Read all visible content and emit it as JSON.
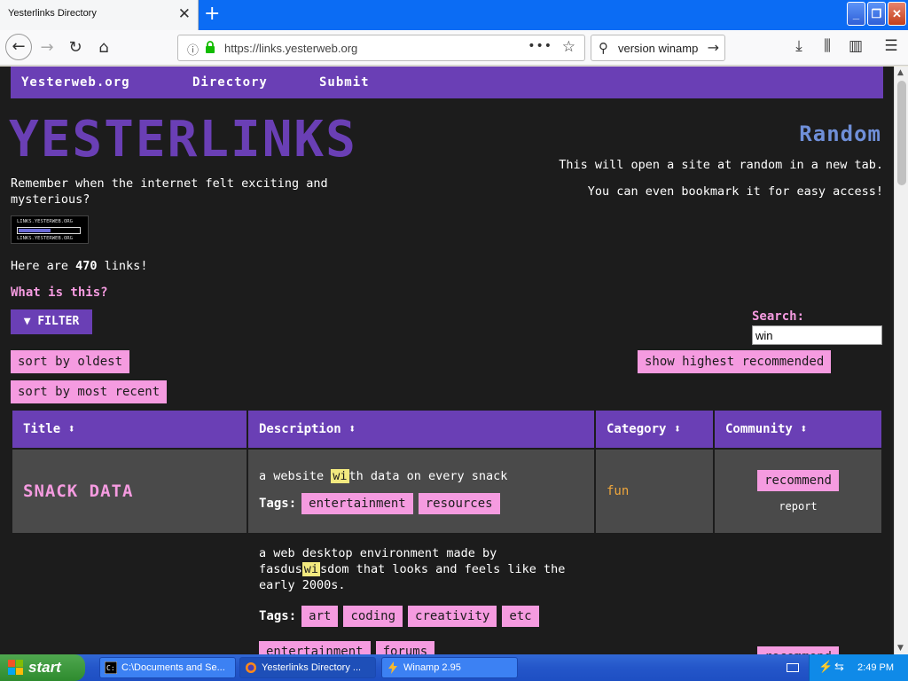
{
  "browser": {
    "tab_title": "Yesterlinks Directory",
    "url": "https://links.yesterweb.org",
    "search_query": "version winamp"
  },
  "nav": {
    "home": "Yesterweb.org",
    "directory": "Directory",
    "submit": "Submit"
  },
  "header": {
    "logo": "YESTERLINKS",
    "tagline": "Remember when the internet felt exciting and mysterious?",
    "badge_text": "LINKS.YESTERWEB.ORG",
    "count_prefix": "Here are ",
    "count": "470",
    "count_suffix": " links!",
    "what_is_this": "What is this?",
    "filter": "FILTER"
  },
  "random": {
    "title": "Random",
    "line1": "This will open a site at random in a new tab.",
    "line2": "You can even bookmark it for easy access!"
  },
  "search": {
    "label": "Search:",
    "value": "win"
  },
  "sort": {
    "oldest": "sort by oldest",
    "recent": "sort by most recent",
    "recommended": "show highest recommended"
  },
  "table": {
    "headers": [
      "Title ⬍",
      "Description ⬍",
      "Category ⬍",
      "Community ⬍"
    ],
    "tags_label": "Tags:",
    "recommend": "recommend",
    "report": "report",
    "rows": [
      {
        "title": "SNACK DATA",
        "desc_a": "a website ",
        "desc_hl": "wi",
        "desc_b": "th data on every snack",
        "tags": [
          "entertainment",
          "resources"
        ],
        "category": "fun"
      },
      {
        "desc_a": "a web desktop environment made by fasdus",
        "desc_hl": "wi",
        "desc_b": "sdom that looks and feels like the early 2000s.",
        "tags": [
          "art",
          "coding",
          "creativity",
          "etc",
          "entertainment",
          "forums"
        ]
      }
    ]
  },
  "taskbar": {
    "start": "start",
    "tasks": [
      "C:\\Documents and Se...",
      "Yesterlinks Directory ...",
      "Winamp 2.95"
    ],
    "time": "2:49 PM"
  }
}
